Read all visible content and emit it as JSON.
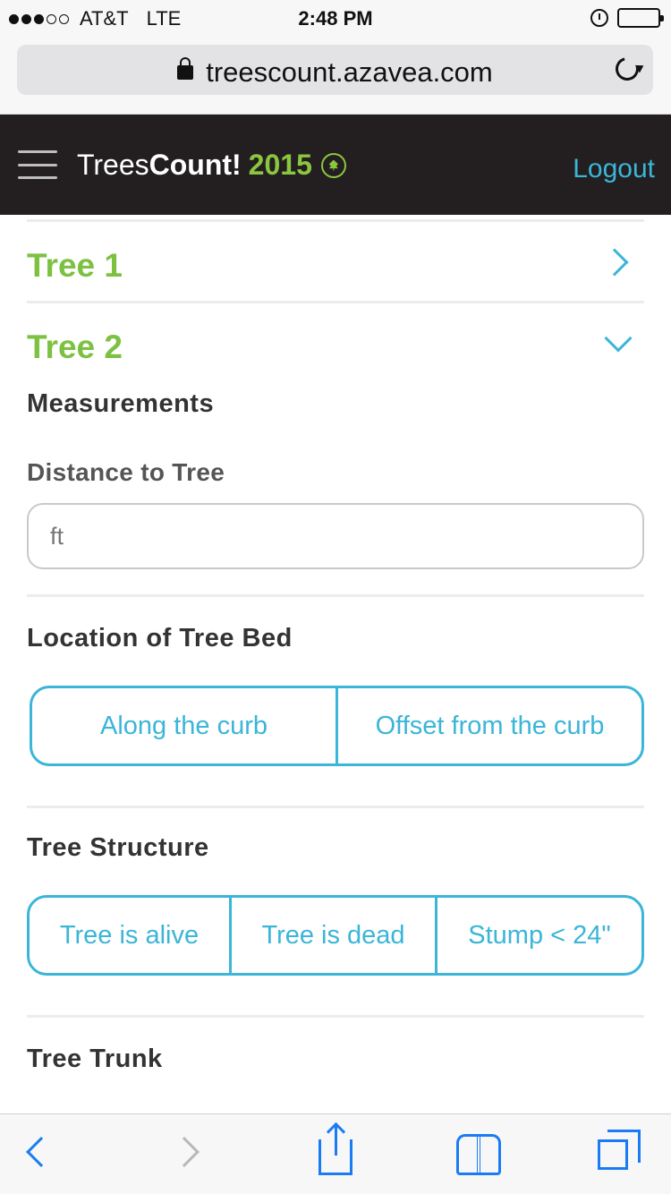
{
  "status_bar": {
    "carrier": "AT&T",
    "network": "LTE",
    "time": "2:48 PM",
    "signal_dots_filled": 3,
    "signal_dots_total": 5,
    "icons": [
      "alarm-icon",
      "battery-icon"
    ]
  },
  "browser": {
    "url": "treescount.azavea.com",
    "icons": [
      "lock-icon",
      "reload-icon"
    ]
  },
  "header": {
    "brand_light": "Trees",
    "brand_bold": "Count!",
    "brand_year": "2015",
    "logout_label": "Logout",
    "colors": {
      "background": "#231f20",
      "brand_green": "#8cc63f",
      "link_blue": "#3bb5d8"
    }
  },
  "trees": [
    {
      "title": "Tree 1",
      "expanded": false
    },
    {
      "title": "Tree 2",
      "expanded": true
    }
  ],
  "form": {
    "measurements_heading": "Measurements",
    "distance_label": "Distance to Tree",
    "distance_placeholder": "ft",
    "tree_bed": {
      "heading": "Location of Tree Bed",
      "options": [
        "Along the curb",
        "Offset from the curb"
      ]
    },
    "structure": {
      "heading": "Tree Structure",
      "options": [
        "Tree is alive",
        "Tree is dead",
        "Stump < 24\""
      ]
    },
    "trunk_heading": "Tree Trunk"
  },
  "toolbar": {
    "icons": [
      "back-icon",
      "forward-icon",
      "share-icon",
      "bookmarks-icon",
      "tabs-icon"
    ]
  },
  "colors": {
    "accent": "#3bb5d8",
    "tree_title_green": "#7dc142",
    "ios_blue": "#1a7cf5"
  }
}
